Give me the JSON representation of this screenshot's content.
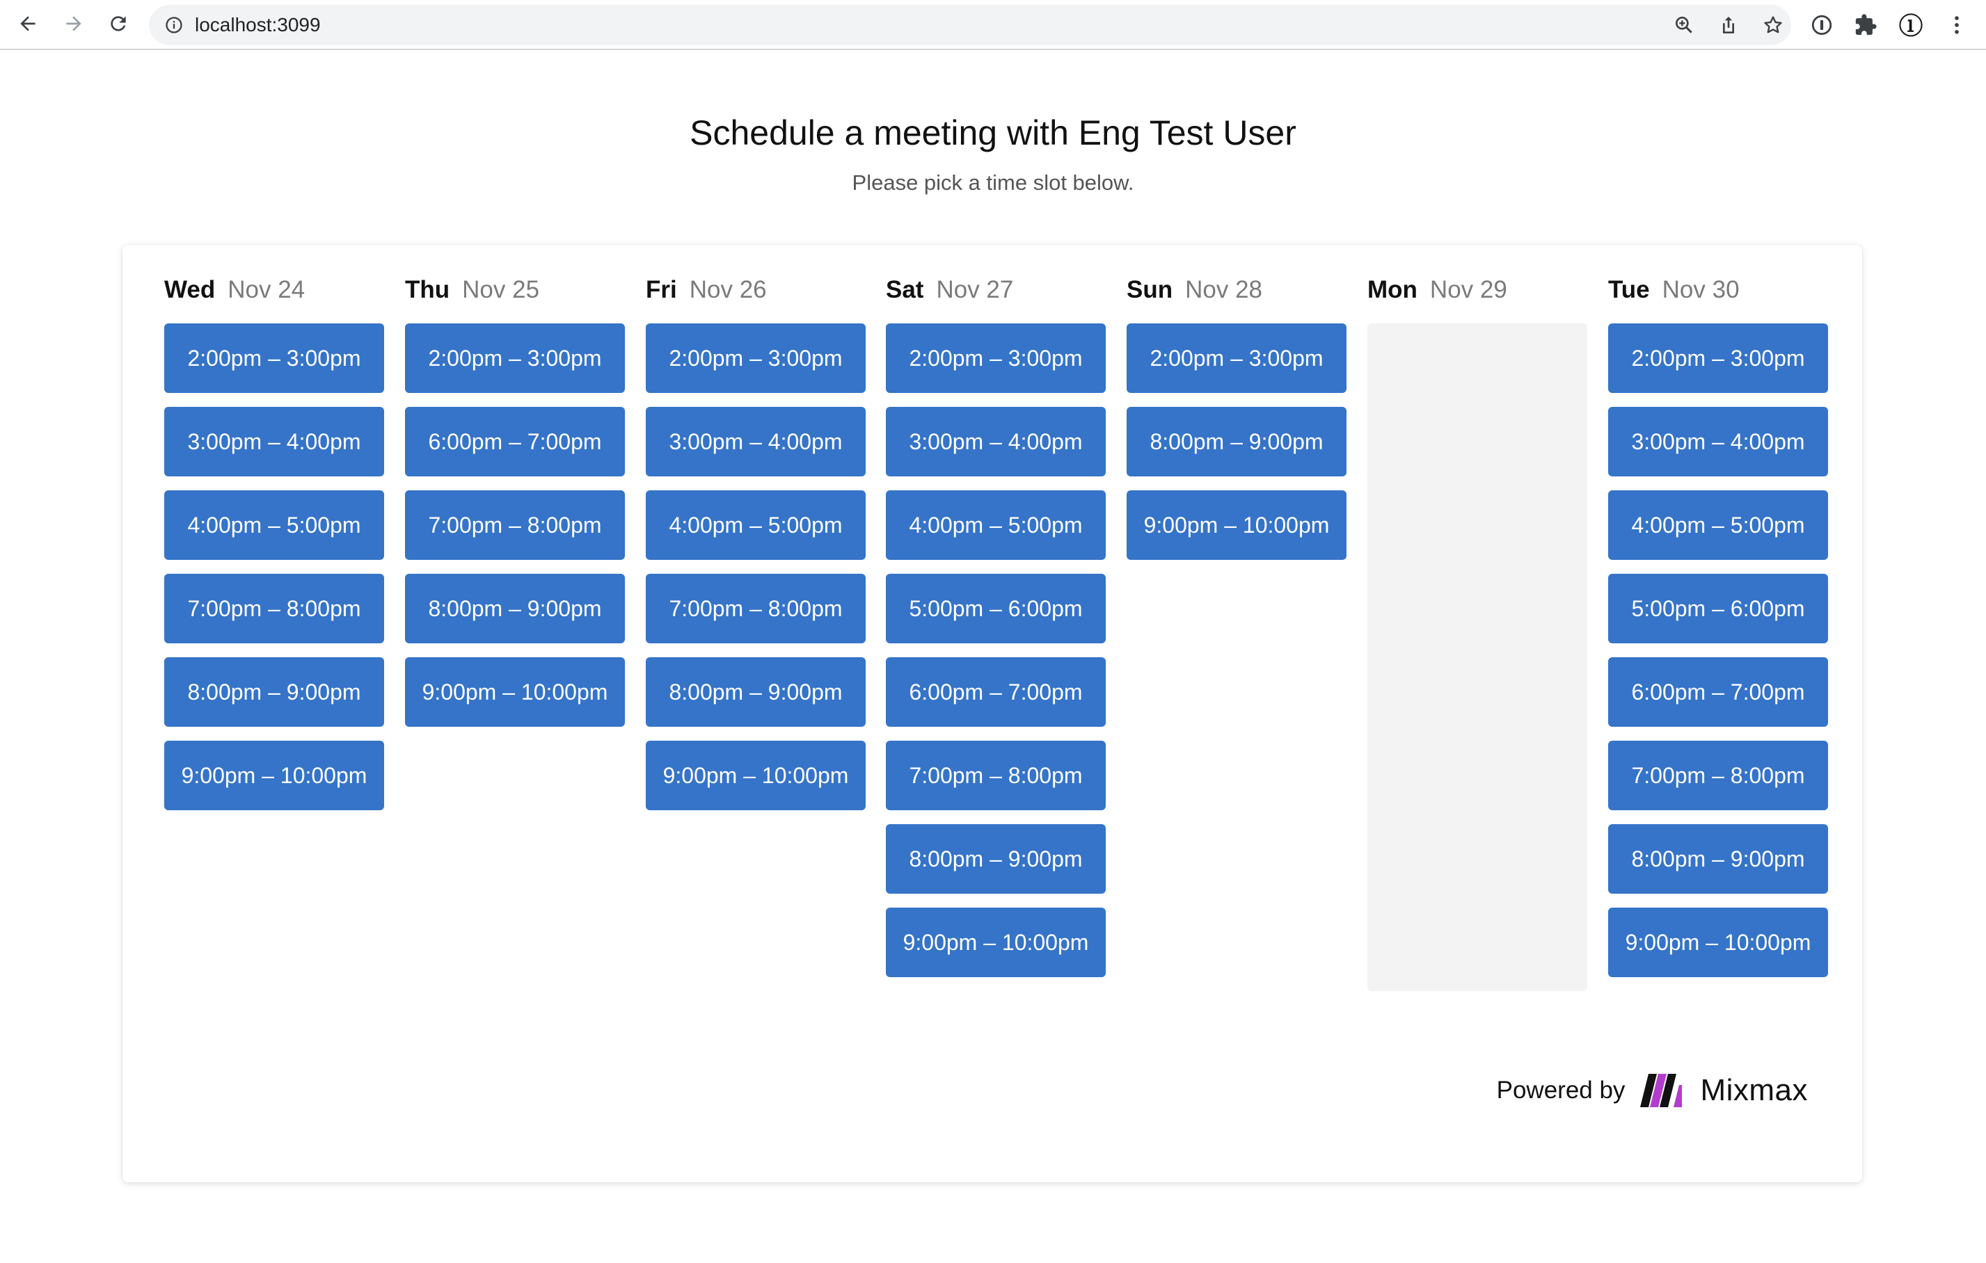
{
  "browser": {
    "url": "localhost:3099"
  },
  "header": {
    "title": "Schedule a meeting with Eng Test User",
    "subtitle": "Please pick a time slot below."
  },
  "days": [
    {
      "name": "Wed",
      "date": "Nov 24",
      "slots": [
        "2:00pm – 3:00pm",
        "3:00pm – 4:00pm",
        "4:00pm – 5:00pm",
        "7:00pm – 8:00pm",
        "8:00pm – 9:00pm",
        "9:00pm – 10:00pm"
      ]
    },
    {
      "name": "Thu",
      "date": "Nov 25",
      "slots": [
        "2:00pm – 3:00pm",
        "6:00pm – 7:00pm",
        "7:00pm – 8:00pm",
        "8:00pm – 9:00pm",
        "9:00pm – 10:00pm"
      ]
    },
    {
      "name": "Fri",
      "date": "Nov 26",
      "slots": [
        "2:00pm – 3:00pm",
        "3:00pm – 4:00pm",
        "4:00pm – 5:00pm",
        "7:00pm – 8:00pm",
        "8:00pm – 9:00pm",
        "9:00pm – 10:00pm"
      ]
    },
    {
      "name": "Sat",
      "date": "Nov 27",
      "slots": [
        "2:00pm – 3:00pm",
        "3:00pm – 4:00pm",
        "4:00pm – 5:00pm",
        "5:00pm – 6:00pm",
        "6:00pm – 7:00pm",
        "7:00pm – 8:00pm",
        "8:00pm – 9:00pm",
        "9:00pm – 10:00pm"
      ]
    },
    {
      "name": "Sun",
      "date": "Nov 28",
      "slots": [
        "2:00pm – 3:00pm",
        "8:00pm – 9:00pm",
        "9:00pm – 10:00pm"
      ]
    },
    {
      "name": "Mon",
      "date": "Nov 29",
      "slots": []
    },
    {
      "name": "Tue",
      "date": "Nov 30",
      "slots": [
        "2:00pm – 3:00pm",
        "3:00pm – 4:00pm",
        "4:00pm – 5:00pm",
        "5:00pm – 6:00pm",
        "6:00pm – 7:00pm",
        "7:00pm – 8:00pm",
        "8:00pm – 9:00pm",
        "9:00pm – 10:00pm"
      ]
    }
  ],
  "footer": {
    "powered_by": "Powered by",
    "brand": "Mixmax"
  },
  "colors": {
    "slot_background": "#3574c8",
    "slot_text": "#ffffff",
    "empty_day_background": "#f3f3f3",
    "brand_logo": "#b23cce"
  },
  "icons": {
    "back": "back-arrow-icon",
    "forward": "forward-arrow-icon",
    "reload": "reload-icon",
    "site_info": "info-icon",
    "zoom": "zoom-icon",
    "share": "share-icon",
    "bookmark": "star-icon",
    "extensions": [
      "password-manager-icon",
      "puzzle-icon",
      "onepassword-icon",
      "menu-kebab-icon"
    ]
  }
}
